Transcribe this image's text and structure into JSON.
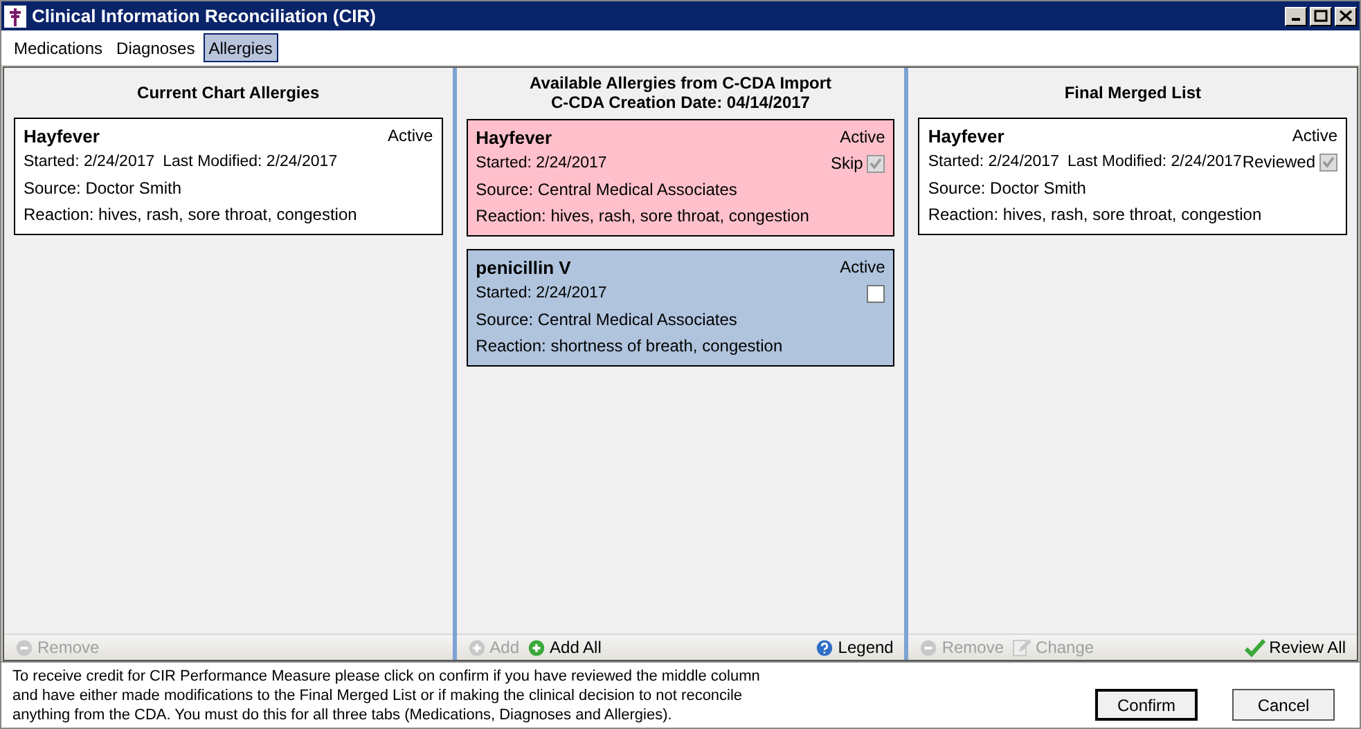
{
  "window": {
    "title": "Clinical Information Reconciliation (CIR)"
  },
  "tabs": [
    {
      "label": "Medications",
      "selected": false
    },
    {
      "label": "Diagnoses",
      "selected": false
    },
    {
      "label": "Allergies",
      "selected": true
    }
  ],
  "columns": [
    {
      "heading": [
        "Current Chart Allergies"
      ],
      "cards": [
        {
          "name": "Hayfever",
          "status": "Active",
          "started": "Started: 2/24/2017",
          "modified": "Last Modified: 2/24/2017",
          "source": "Source: Doctor Smith",
          "reaction": "Reaction: hives, rash, sore throat, congestion",
          "color": "#ffffff"
        }
      ],
      "actions": [
        {
          "label": "Remove",
          "kind": "remove",
          "disabled": true
        }
      ]
    },
    {
      "heading": [
        "Available Allergies from C-CDA Import",
        "C-CDA Creation Date: 04/14/2017"
      ],
      "cards": [
        {
          "name": "Hayfever",
          "status": "Active",
          "started": "Started: 2/24/2017",
          "source": "Source: Central Medical Associates",
          "reaction": "Reaction: hives, rash, sore throat, congestion",
          "color": "#ffc0cb",
          "check": {
            "label": "Skip",
            "checked": true,
            "disabled": true
          }
        },
        {
          "name": "penicillin V",
          "status": "Active",
          "started": "Started: 2/24/2017",
          "source": "Source: Central Medical Associates",
          "reaction": "Reaction: shortness of breath, congestion",
          "color": "#b0c4de",
          "check": {
            "checked": false,
            "disabled": false
          }
        }
      ],
      "actions": [
        {
          "label": "Add",
          "kind": "add",
          "disabled": true
        },
        {
          "label": "Add All",
          "kind": "add",
          "disabled": false
        },
        {
          "label": "Legend",
          "kind": "help",
          "disabled": false,
          "right": true
        }
      ]
    },
    {
      "heading": [
        "Final Merged List"
      ],
      "cards": [
        {
          "name": "Hayfever",
          "status": "Active",
          "started": "Started: 2/24/2017",
          "modified": "Last Modified: 2/24/2017",
          "source": "Source: Doctor Smith",
          "reaction": "Reaction: hives, rash, sore throat, congestion",
          "color": "#ffffff",
          "check": {
            "label": "Reviewed",
            "checked": true,
            "disabled": true
          }
        }
      ],
      "actions": [
        {
          "label": "Remove",
          "kind": "remove",
          "disabled": true
        },
        {
          "label": "Change",
          "kind": "edit",
          "disabled": true
        },
        {
          "label": "Review All",
          "kind": "tick",
          "disabled": false,
          "right": true
        }
      ]
    }
  ],
  "notice": "To receive credit for CIR Performance Measure please click on confirm if you have reviewed the middle column and have either made modifications to the Final Merged List or if making the clinical decision to not reconcile anything from the CDA. You must do this for all three tabs (Medications, Diagnoses and Allergies).",
  "buttons": [
    {
      "label": "Confirm",
      "default": true
    },
    {
      "label": "Cancel",
      "default": false
    }
  ]
}
